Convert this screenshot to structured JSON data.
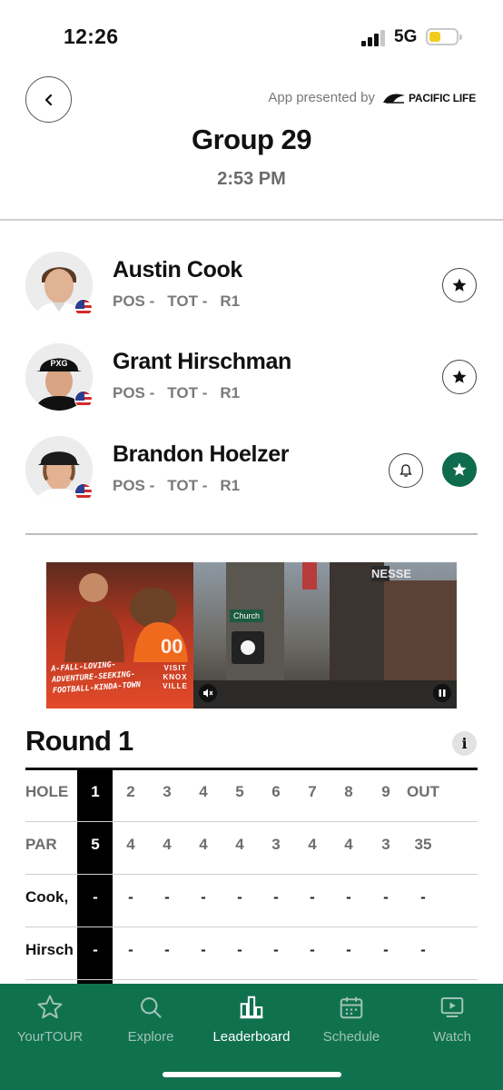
{
  "status_bar": {
    "time": "12:26",
    "network": "5G"
  },
  "header": {
    "presented_by": "App presented by",
    "sponsor": "PACIFIC LIFE",
    "title": "Group 29",
    "tee_time": "2:53 PM"
  },
  "players": [
    {
      "name": "Austin Cook",
      "pos": "POS -",
      "tot": "TOT -",
      "round": "R1",
      "country": "USA",
      "favorite": false,
      "alert": false
    },
    {
      "name": "Grant Hirschman",
      "pos": "POS -",
      "tot": "TOT -",
      "round": "R1",
      "country": "USA",
      "favorite": false,
      "alert": false
    },
    {
      "name": "Brandon Hoelzer",
      "pos": "POS -",
      "tot": "TOT -",
      "round": "R1",
      "country": "USA",
      "favorite": true,
      "alert": true
    }
  ],
  "ad": {
    "tagline": "A-FALL-LOVING-ADVENTURE-SEEKING-FOOTBALL-KINDA-TOWN",
    "brand": "VISIT KNOX VILLE",
    "sign_text": "Church",
    "neon_text": "NESSE"
  },
  "scorecard": {
    "title": "Round 1",
    "info_icon": "i",
    "current_hole_index": 0,
    "rows": [
      {
        "label": "HOLE",
        "cells": [
          "1",
          "2",
          "3",
          "4",
          "5",
          "6",
          "7",
          "8",
          "9",
          "OUT"
        ]
      },
      {
        "label": "PAR",
        "cells": [
          "5",
          "4",
          "4",
          "4",
          "4",
          "3",
          "4",
          "4",
          "3",
          "35"
        ]
      },
      {
        "label": "Cook,",
        "cells": [
          "-",
          "-",
          "-",
          "-",
          "-",
          "-",
          "-",
          "-",
          "-",
          "-"
        ]
      },
      {
        "label": "Hirsch",
        "cells": [
          "-",
          "-",
          "-",
          "-",
          "-",
          "-",
          "-",
          "-",
          "-",
          "-"
        ]
      }
    ]
  },
  "tab_bar": {
    "active": "Leaderboard",
    "tabs": [
      {
        "label": "YourTOUR",
        "icon": "star-outline-icon"
      },
      {
        "label": "Explore",
        "icon": "search-icon"
      },
      {
        "label": "Leaderboard",
        "icon": "bar-chart-icon"
      },
      {
        "label": "Schedule",
        "icon": "calendar-icon"
      },
      {
        "label": "Watch",
        "icon": "play-screen-icon"
      }
    ]
  },
  "colors": {
    "brand_green": "#10714f",
    "active_star": "#0f6b4d",
    "battery": "#f3cc1d"
  }
}
